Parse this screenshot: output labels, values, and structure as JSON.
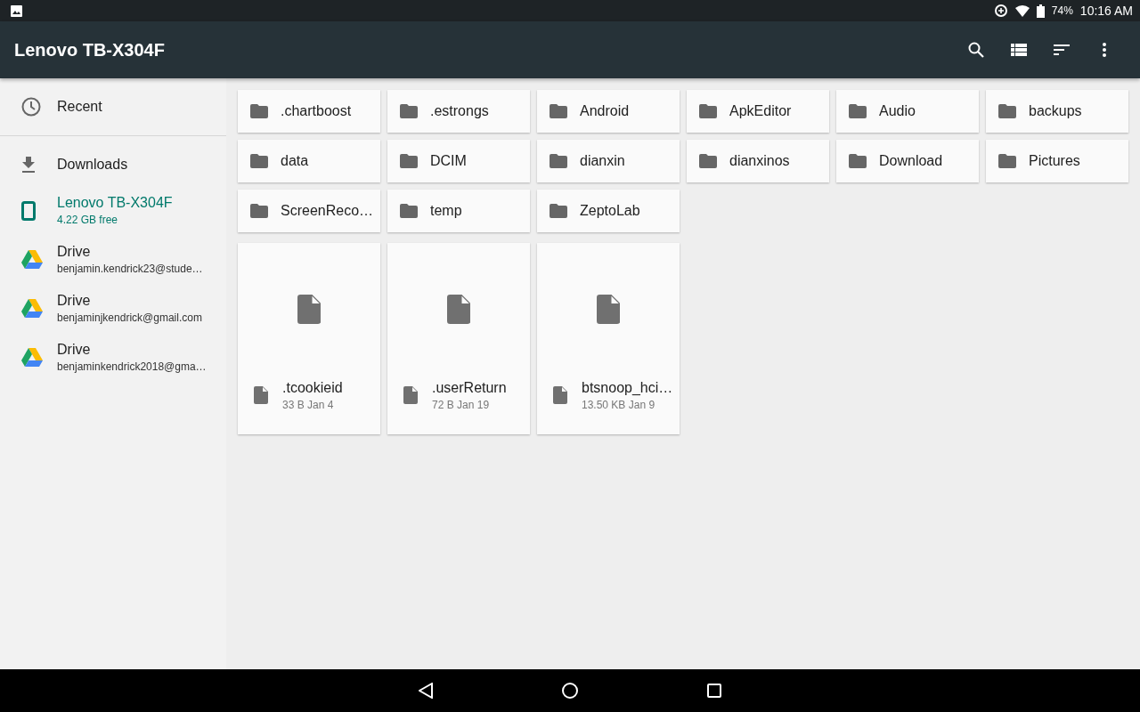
{
  "status_bar": {
    "battery": "74%",
    "time": "10:16 AM"
  },
  "app_bar": {
    "title": "Lenovo TB-X304F"
  },
  "sidebar": {
    "items": [
      {
        "kind": "recent",
        "label": "Recent",
        "selected": false,
        "divider_after": true
      },
      {
        "kind": "downloads",
        "label": "Downloads",
        "selected": false
      },
      {
        "kind": "device",
        "label": "Lenovo TB-X304F",
        "subtitle": "4.22 GB free",
        "selected": true
      },
      {
        "kind": "drive",
        "label": "Drive",
        "subtitle": "benjamin.kendrick23@stude…",
        "selected": false
      },
      {
        "kind": "drive",
        "label": "Drive",
        "subtitle": "benjaminjkendrick@gmail.com",
        "selected": false
      },
      {
        "kind": "drive",
        "label": "Drive",
        "subtitle": "benjaminkendrick2018@gma…",
        "selected": false
      }
    ]
  },
  "folders": [
    ".chartboost",
    ".estrongs",
    "Android",
    "ApkEditor",
    "Audio",
    "backups",
    "data",
    "DCIM",
    "dianxin",
    "dianxinos",
    "Download",
    "Pictures",
    "ScreenReco…",
    "temp",
    "ZeptoLab"
  ],
  "files": [
    {
      "name": ".tcookieid",
      "details": "33 B Jan 4"
    },
    {
      "name": ".userReturn",
      "details": "72 B Jan 19"
    },
    {
      "name": "btsnoop_hci…",
      "details": "13.50 KB Jan 9"
    }
  ]
}
